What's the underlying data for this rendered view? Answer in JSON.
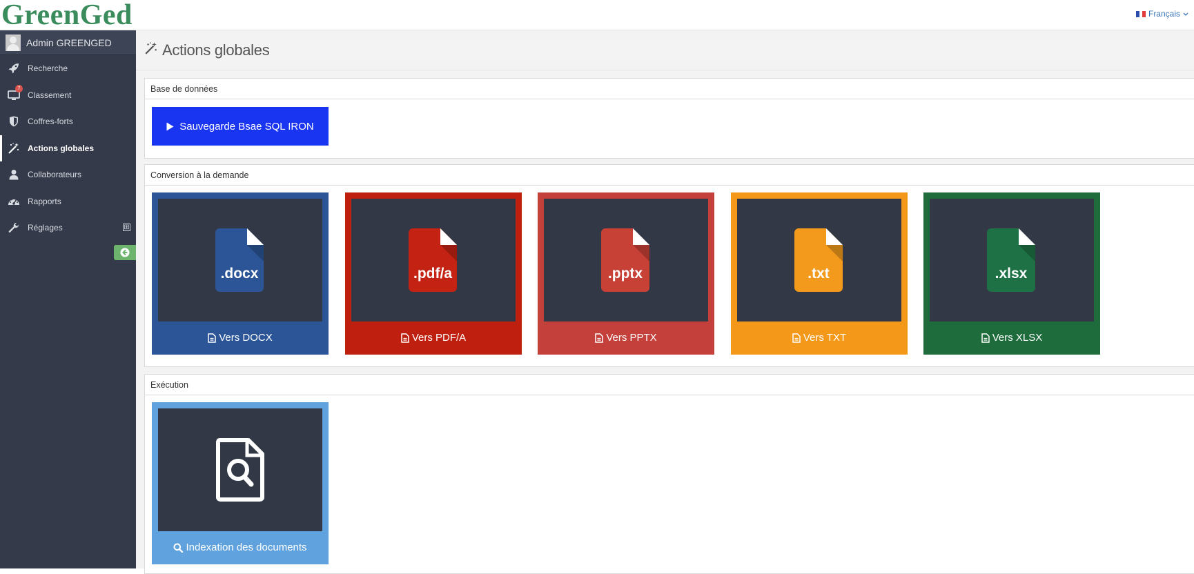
{
  "app": {
    "logo": "GreenGed",
    "language": "Français"
  },
  "user": {
    "name": "Admin GREENGED"
  },
  "sidebar": {
    "items": [
      {
        "label": "Recherche",
        "icon": "rocket-icon"
      },
      {
        "label": "Classement",
        "icon": "monitor-icon",
        "badge": "7"
      },
      {
        "label": "Coffres-forts",
        "icon": "shield-icon"
      },
      {
        "label": "Actions globales",
        "icon": "magic-wand-icon",
        "active": true
      },
      {
        "label": "Collaborateurs",
        "icon": "user-icon"
      },
      {
        "label": "Rapports",
        "icon": "dashboard-icon"
      },
      {
        "label": "Réglages",
        "icon": "wrench-icon",
        "expand": "⊞"
      }
    ]
  },
  "page": {
    "title": "Actions globales"
  },
  "database": {
    "heading": "Base de données",
    "button_label": "Sauvegarde Bsae SQL IRON",
    "button_color": "#1a35f2"
  },
  "conversion": {
    "heading": "Conversion à la demande",
    "tiles": [
      {
        "ext": ".docx",
        "label": "Vers DOCX",
        "color": "#2b5597",
        "doc_color": "#2b5597"
      },
      {
        "ext": ".pdf/a",
        "label": "Vers PDF/A",
        "color": "#bf1f0e",
        "doc_color": "#c42314"
      },
      {
        "ext": ".pptx",
        "label": "Vers PPTX",
        "color": "#c3413a",
        "doc_color": "#c84137"
      },
      {
        "ext": ".txt",
        "label": "Vers TXT",
        "color": "#f39819",
        "doc_color": "#f39a1d"
      },
      {
        "ext": ".xlsx",
        "label": "Vers XLSX",
        "color": "#1e6b3c",
        "doc_color": "#1e7145"
      }
    ]
  },
  "execution": {
    "heading": "Exécution",
    "tile_label": "Indexation des documents",
    "tile_color": "#5fa2dd"
  }
}
